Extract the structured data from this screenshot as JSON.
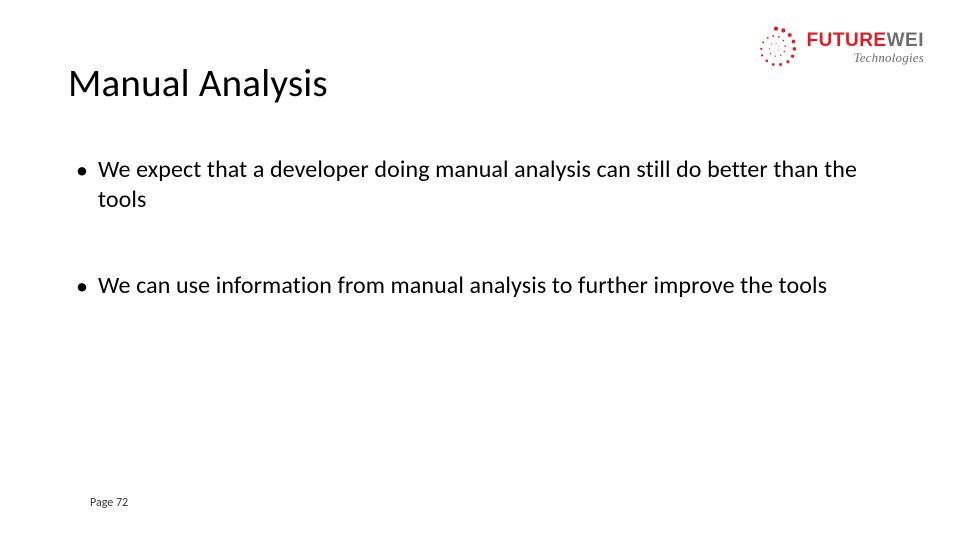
{
  "title": "Manual Analysis",
  "bullets": [
    "We expect that a developer doing manual analysis can still do better than the tools",
    "We can use information from manual analysis to further improve the tools"
  ],
  "footer": {
    "page_label": "Page",
    "page_number": "72"
  },
  "logo": {
    "future": "FUTURE",
    "wei": "WEI",
    "technologies": "Technologies"
  },
  "colors": {
    "brand_red": "#e31b23",
    "brand_gray": "#6e6e6e"
  }
}
